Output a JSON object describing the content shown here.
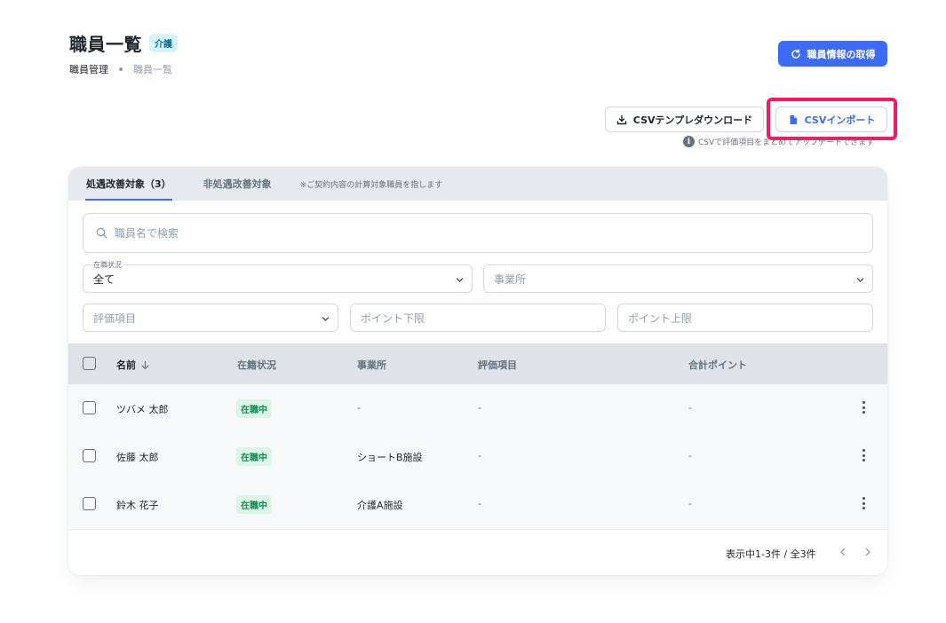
{
  "header": {
    "title": "職員一覧",
    "badge": "介護",
    "breadcrumb": [
      "職員管理",
      "職員一覧"
    ],
    "fetch_button": "職員情報の取得"
  },
  "actions": {
    "download_button": "CSVテンプレダウンロード",
    "import_button": "CSVインポート",
    "import_hint": "CSVで評価項目をまとめてアップデートできます"
  },
  "tabs": {
    "items": [
      {
        "label": "処遇改善対象（3）",
        "active": true
      },
      {
        "label": "非処遇改善対象",
        "active": false
      }
    ],
    "note": "※ご契約内容の計算対象職員を指します"
  },
  "filters": {
    "search_placeholder": "職員名で検索",
    "status_label": "在職状況",
    "status_value": "全て",
    "office_placeholder": "事業所",
    "item_placeholder": "評価項目",
    "point_min_placeholder": "ポイント下限",
    "point_max_placeholder": "ポイント上限"
  },
  "table": {
    "columns": [
      "名前",
      "在籍状況",
      "事業所",
      "評価項目",
      "合計ポイント"
    ],
    "rows": [
      {
        "name": "ツバメ 太郎",
        "status": "在職中",
        "office": "-",
        "item": "-",
        "points": "-"
      },
      {
        "name": "佐藤 太郎",
        "status": "在職中",
        "office": "ショートB施設",
        "item": "-",
        "points": "-"
      },
      {
        "name": "鈴木 花子",
        "status": "在職中",
        "office": "介護A施設",
        "item": "-",
        "points": "-"
      }
    ],
    "pagination": "表示中1-3件 / 全3件"
  },
  "colors": {
    "primary": "#3d6bf5",
    "highlight": "#f0196a",
    "status_green": "#118d57"
  }
}
